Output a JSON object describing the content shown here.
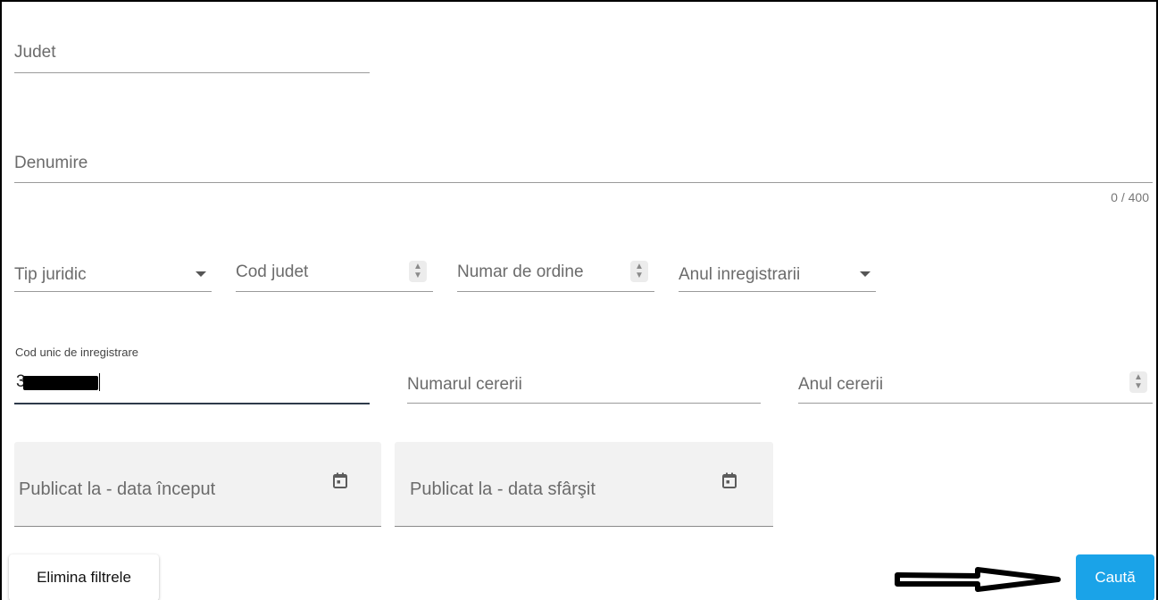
{
  "form": {
    "judet": {
      "label": "Judet"
    },
    "denumire": {
      "label": "Denumire",
      "counter": "0 / 400"
    },
    "tip_juridic": {
      "label": "Tip juridic"
    },
    "cod_judet": {
      "label": "Cod judet"
    },
    "numar_ordine": {
      "label": "Numar de ordine"
    },
    "anul_inregistrarii": {
      "label": "Anul inregistrarii"
    },
    "cui": {
      "label": "Cod unic de inregistrare",
      "value_visible": "3"
    },
    "numarul_cererii": {
      "label": "Numarul cererii"
    },
    "anul_cererii": {
      "label": "Anul cererii"
    },
    "data_inceput": {
      "label": "Publicat la - data început"
    },
    "data_sfarsit": {
      "label": "Publicat la - data sfârşit"
    }
  },
  "actions": {
    "clear_label": "Elimina filtrele",
    "search_label": "Caută"
  },
  "icons": {
    "dropdown": "chevron-down-icon",
    "spinner": "number-spinner-icon",
    "calendar": "calendar-icon",
    "arrow": "right-arrow-annotation-icon"
  },
  "colors": {
    "primary": "#1aa3e8",
    "filled_bg": "#f2f2f2"
  }
}
